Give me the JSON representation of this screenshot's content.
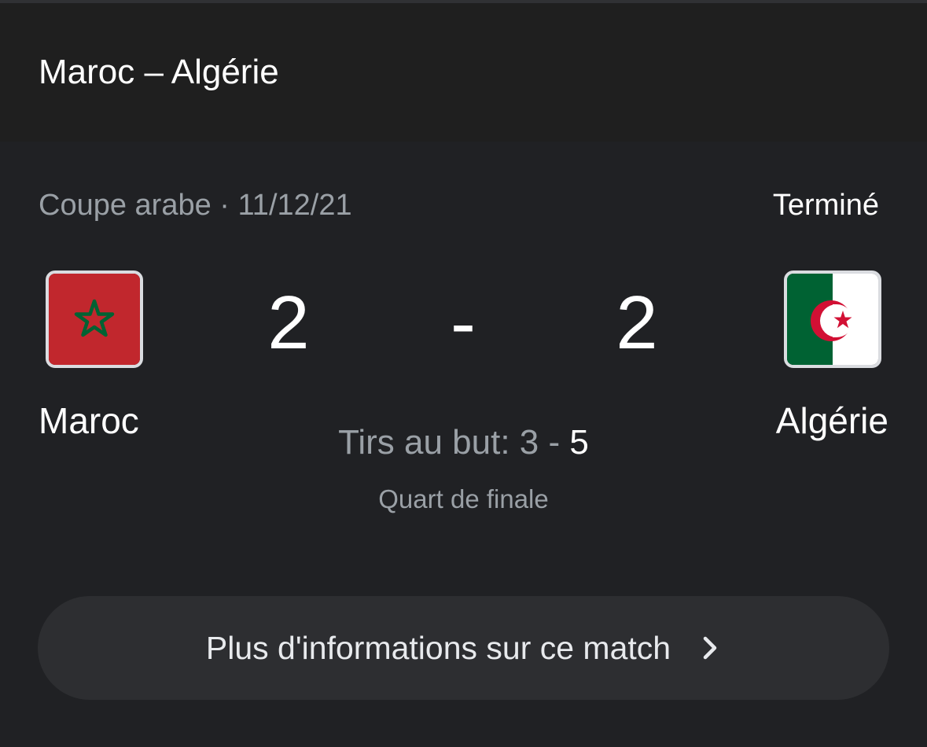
{
  "header": {
    "title": "Maroc – Algérie"
  },
  "match": {
    "competition_date": "Coupe arabe · 11/12/21",
    "status": "Terminé",
    "home": {
      "name": "Maroc",
      "score": "2",
      "flag_icon": "morocco-flag-icon",
      "flag_colors": {
        "field": "#c1272d",
        "star": "#006233"
      }
    },
    "separator": "-",
    "away": {
      "name": "Algérie",
      "score": "2",
      "flag_icon": "algeria-flag-icon",
      "flag_colors": {
        "green": "#006233",
        "white": "#ffffff",
        "red": "#d21034"
      }
    },
    "penalties": {
      "label": "Tirs au but: ",
      "home": "3",
      "dash": " - ",
      "away": "5"
    },
    "round": "Quart de finale"
  },
  "more_info": {
    "label": "Plus d'informations sur ce match",
    "icon": "chevron-right-icon"
  },
  "colors": {
    "background": "#202124",
    "header_bg": "#1f1f1f",
    "button_bg": "#2d2e31",
    "secondary_text": "#9aa0a6",
    "primary_text": "#ffffff"
  }
}
